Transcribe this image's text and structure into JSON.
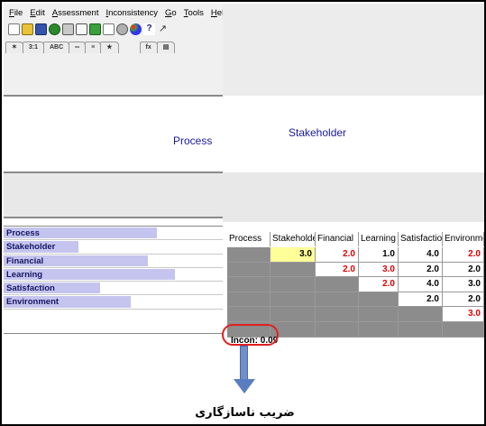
{
  "menu": [
    "File",
    "Edit",
    "Assessment",
    "Inconsistency",
    "Go",
    "Tools",
    "Help"
  ],
  "toolbar_icons": [
    "new-icon",
    "open-folder-icon",
    "save-icon",
    "check-icon",
    "print-icon",
    "print-preview-icon",
    "green-icon",
    "chart-icon",
    "gear-icon",
    "color-wheel-icon",
    "help-icon",
    "arrow-icon"
  ],
  "tabs": [
    "✶",
    "3:1",
    "ABC",
    "═",
    "≡",
    "★",
    "fx",
    "▤"
  ],
  "goal_label": "Process",
  "current_label": "Stakeholder",
  "criteria": [
    {
      "label": "Process",
      "weight": 0.7
    },
    {
      "label": "Stakeholder",
      "weight": 0.34
    },
    {
      "label": "Financial",
      "weight": 0.66
    },
    {
      "label": "Learning",
      "weight": 0.78
    },
    {
      "label": "Satisfaction",
      "weight": 0.44
    },
    {
      "label": "Environment",
      "weight": 0.58
    }
  ],
  "matrix": {
    "columns": [
      "Process",
      "Stakeholde",
      "Financial",
      "Learning",
      "Satisfactior",
      "Environmer"
    ],
    "rows": [
      [
        "",
        "3.0",
        "2.0",
        "1.0",
        "4.0",
        "2.0"
      ],
      [
        "",
        "",
        "2.0",
        "3.0",
        "2.0",
        "2.0"
      ],
      [
        "",
        "",
        "",
        "2.0",
        "4.0",
        "3.0"
      ],
      [
        "",
        "",
        "",
        "",
        "2.0",
        "2.0"
      ],
      [
        "",
        "",
        "",
        "",
        "",
        "3.0"
      ],
      [
        "",
        "",
        "",
        "",
        "",
        ""
      ]
    ]
  },
  "inconsistency_text": "Incon: 0.09",
  "caption": "ضریب ناسازگاری",
  "colors": {
    "red_value": "#e00000",
    "yellow_cell": "#ffff99",
    "gray_cell": "#8c8c8c",
    "bar": "#c4c4ee",
    "highlight": "#e02020",
    "arrow": "#5a7dc0"
  }
}
